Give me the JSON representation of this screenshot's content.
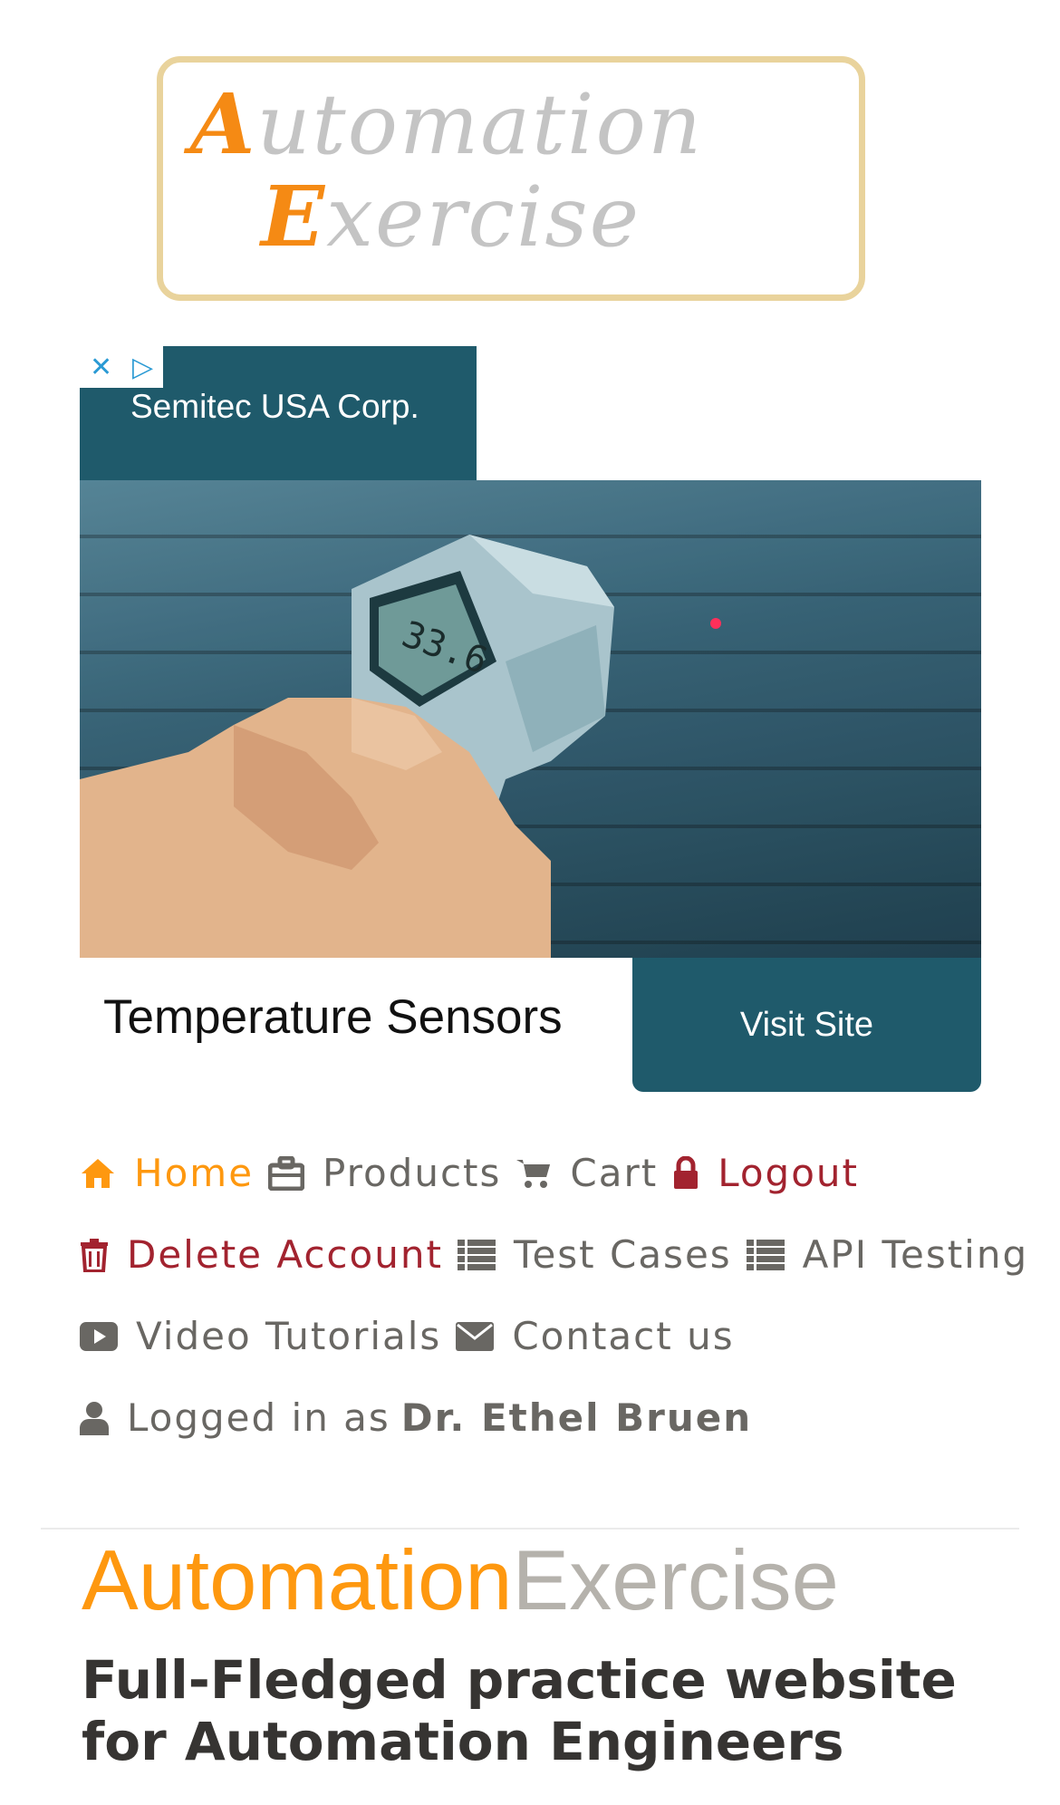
{
  "logo": {
    "line1_cap": "A",
    "line1_rest": "utomation",
    "line2_cap": "E",
    "line2_rest": "xercise"
  },
  "ad": {
    "adchoices_close_glyph": "✕",
    "adchoices_glyph": "▷",
    "company": "Semitec USA Corp.",
    "display_reading": "33.6",
    "tagline": "Temperature Sensors",
    "cta": "Visit Site"
  },
  "nav": {
    "home": "Home",
    "products": "Products",
    "cart": "Cart",
    "logout": "Logout",
    "delete_account": "Delete Account",
    "test_cases": "Test Cases",
    "api_testing": "API Testing",
    "video_tutorials": "Video Tutorials",
    "contact_us": "Contact us",
    "logged_in_as": "Logged in as",
    "username": "Dr. Ethel Bruen"
  },
  "hero": {
    "brand_part1": "Automation",
    "brand_part2": "Exercise",
    "headline": "Full-Fledged practice website for Automation Engineers"
  },
  "colors": {
    "accent": "#fe980f",
    "danger": "#a2232f",
    "text": "#696763",
    "ad_teal": "#1f5a6b"
  }
}
